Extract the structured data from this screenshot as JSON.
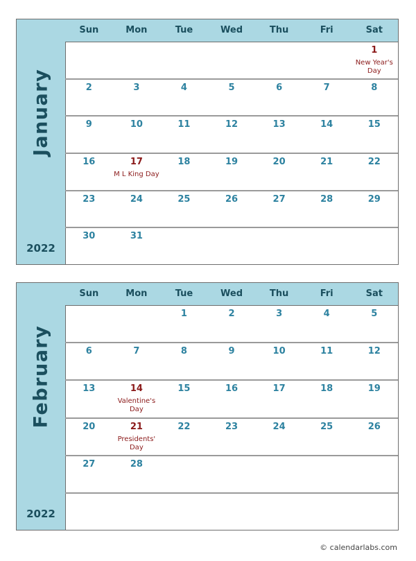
{
  "weekdays": [
    "Sun",
    "Mon",
    "Tue",
    "Wed",
    "Thu",
    "Fri",
    "Sat"
  ],
  "months": [
    {
      "name": "January",
      "year": "2022",
      "weeks": [
        [
          {
            "d": ""
          },
          {
            "d": ""
          },
          {
            "d": ""
          },
          {
            "d": ""
          },
          {
            "d": ""
          },
          {
            "d": ""
          },
          {
            "d": "1",
            "holiday": "New Year's Day"
          }
        ],
        [
          {
            "d": "2"
          },
          {
            "d": "3"
          },
          {
            "d": "4"
          },
          {
            "d": "5"
          },
          {
            "d": "6"
          },
          {
            "d": "7"
          },
          {
            "d": "8"
          }
        ],
        [
          {
            "d": "9"
          },
          {
            "d": "10"
          },
          {
            "d": "11"
          },
          {
            "d": "12"
          },
          {
            "d": "13"
          },
          {
            "d": "14"
          },
          {
            "d": "15"
          }
        ],
        [
          {
            "d": "16"
          },
          {
            "d": "17",
            "holiday": "M L King Day"
          },
          {
            "d": "18"
          },
          {
            "d": "19"
          },
          {
            "d": "20"
          },
          {
            "d": "21"
          },
          {
            "d": "22"
          }
        ],
        [
          {
            "d": "23"
          },
          {
            "d": "24"
          },
          {
            "d": "25"
          },
          {
            "d": "26"
          },
          {
            "d": "27"
          },
          {
            "d": "28"
          },
          {
            "d": "29"
          }
        ],
        [
          {
            "d": "30"
          },
          {
            "d": "31"
          },
          {
            "d": ""
          },
          {
            "d": ""
          },
          {
            "d": ""
          },
          {
            "d": ""
          },
          {
            "d": ""
          }
        ]
      ]
    },
    {
      "name": "February",
      "year": "2022",
      "weeks": [
        [
          {
            "d": ""
          },
          {
            "d": ""
          },
          {
            "d": "1"
          },
          {
            "d": "2"
          },
          {
            "d": "3"
          },
          {
            "d": "4"
          },
          {
            "d": "5"
          }
        ],
        [
          {
            "d": "6"
          },
          {
            "d": "7"
          },
          {
            "d": "8"
          },
          {
            "d": "9"
          },
          {
            "d": "10"
          },
          {
            "d": "11"
          },
          {
            "d": "12"
          }
        ],
        [
          {
            "d": "13"
          },
          {
            "d": "14",
            "holiday": "Valentine's Day"
          },
          {
            "d": "15"
          },
          {
            "d": "16"
          },
          {
            "d": "17"
          },
          {
            "d": "18"
          },
          {
            "d": "19"
          }
        ],
        [
          {
            "d": "20"
          },
          {
            "d": "21",
            "holiday": "Presidents' Day"
          },
          {
            "d": "22"
          },
          {
            "d": "23"
          },
          {
            "d": "24"
          },
          {
            "d": "25"
          },
          {
            "d": "26"
          }
        ],
        [
          {
            "d": "27"
          },
          {
            "d": "28"
          },
          {
            "d": ""
          },
          {
            "d": ""
          },
          {
            "d": ""
          },
          {
            "d": ""
          },
          {
            "d": ""
          }
        ],
        [
          {
            "d": ""
          },
          {
            "d": ""
          },
          {
            "d": ""
          },
          {
            "d": ""
          },
          {
            "d": ""
          },
          {
            "d": ""
          },
          {
            "d": ""
          }
        ]
      ]
    }
  ],
  "colors": {
    "header_bg": "#abd8e3",
    "day_number": "#2d82a0",
    "holiday": "#8b1a1a",
    "title": "#1b4f5e"
  },
  "footer": "© calendarlabs.com"
}
